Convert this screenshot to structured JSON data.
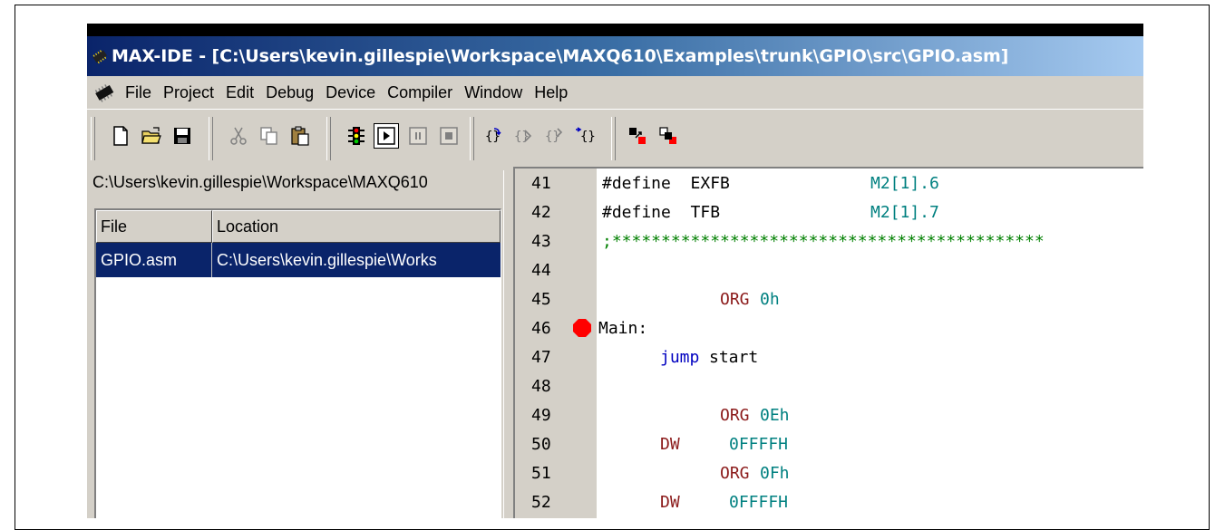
{
  "window": {
    "title": "MAX-IDE - [C:\\Users\\kevin.gillespie\\Workspace\\MAXQ610\\Examples\\trunk\\GPIO\\src\\GPIO.asm]"
  },
  "menu": {
    "items": [
      "File",
      "Project",
      "Edit",
      "Debug",
      "Device",
      "Compiler",
      "Window",
      "Help"
    ]
  },
  "toolbar": {
    "icons": [
      "new-file-icon",
      "open-folder-icon",
      "save-icon",
      "cut-icon",
      "copy-icon",
      "paste-icon",
      "traffic-light-icon",
      "run-icon",
      "pause-icon",
      "stop-icon",
      "step-into-icon",
      "step-over-icon",
      "step-out-icon",
      "step-return-icon",
      "breakpoint-toggle-icon",
      "breakpoint-clear-icon"
    ]
  },
  "file_panel": {
    "path": "C:\\Users\\kevin.gillespie\\Workspace\\MAXQ610",
    "columns": [
      "File",
      "Location"
    ],
    "rows": [
      {
        "file": "GPIO.asm",
        "location": "C:\\Users\\kevin.gillespie\\Works"
      }
    ]
  },
  "editor": {
    "breakpoint_line": "46",
    "colors": {
      "directive": "#000000",
      "keyword": "#8b1a1a",
      "number": "#008080",
      "comment": "#008000",
      "opcode": "#0000c0"
    },
    "lines": [
      {
        "num": "41",
        "a": "#define  EXFB",
        "b": "M2[1].6"
      },
      {
        "num": "42",
        "a": "#define  TFB",
        "b": "M2[1].7"
      },
      {
        "num": "43",
        "comment": ";********************************************"
      },
      {
        "num": "44"
      },
      {
        "num": "45",
        "kw": "ORG",
        "val": "0h"
      },
      {
        "num": "46",
        "label": "Main:"
      },
      {
        "num": "47",
        "op": "jump",
        "arg": "start"
      },
      {
        "num": "48"
      },
      {
        "num": "49",
        "kw": "ORG",
        "val": "0Eh"
      },
      {
        "num": "50",
        "kw": "DW",
        "val": "0FFFFH"
      },
      {
        "num": "51",
        "kw": "ORG",
        "val": "0Fh"
      },
      {
        "num": "52",
        "kw": "DW",
        "val": "0FFFFH"
      }
    ]
  }
}
